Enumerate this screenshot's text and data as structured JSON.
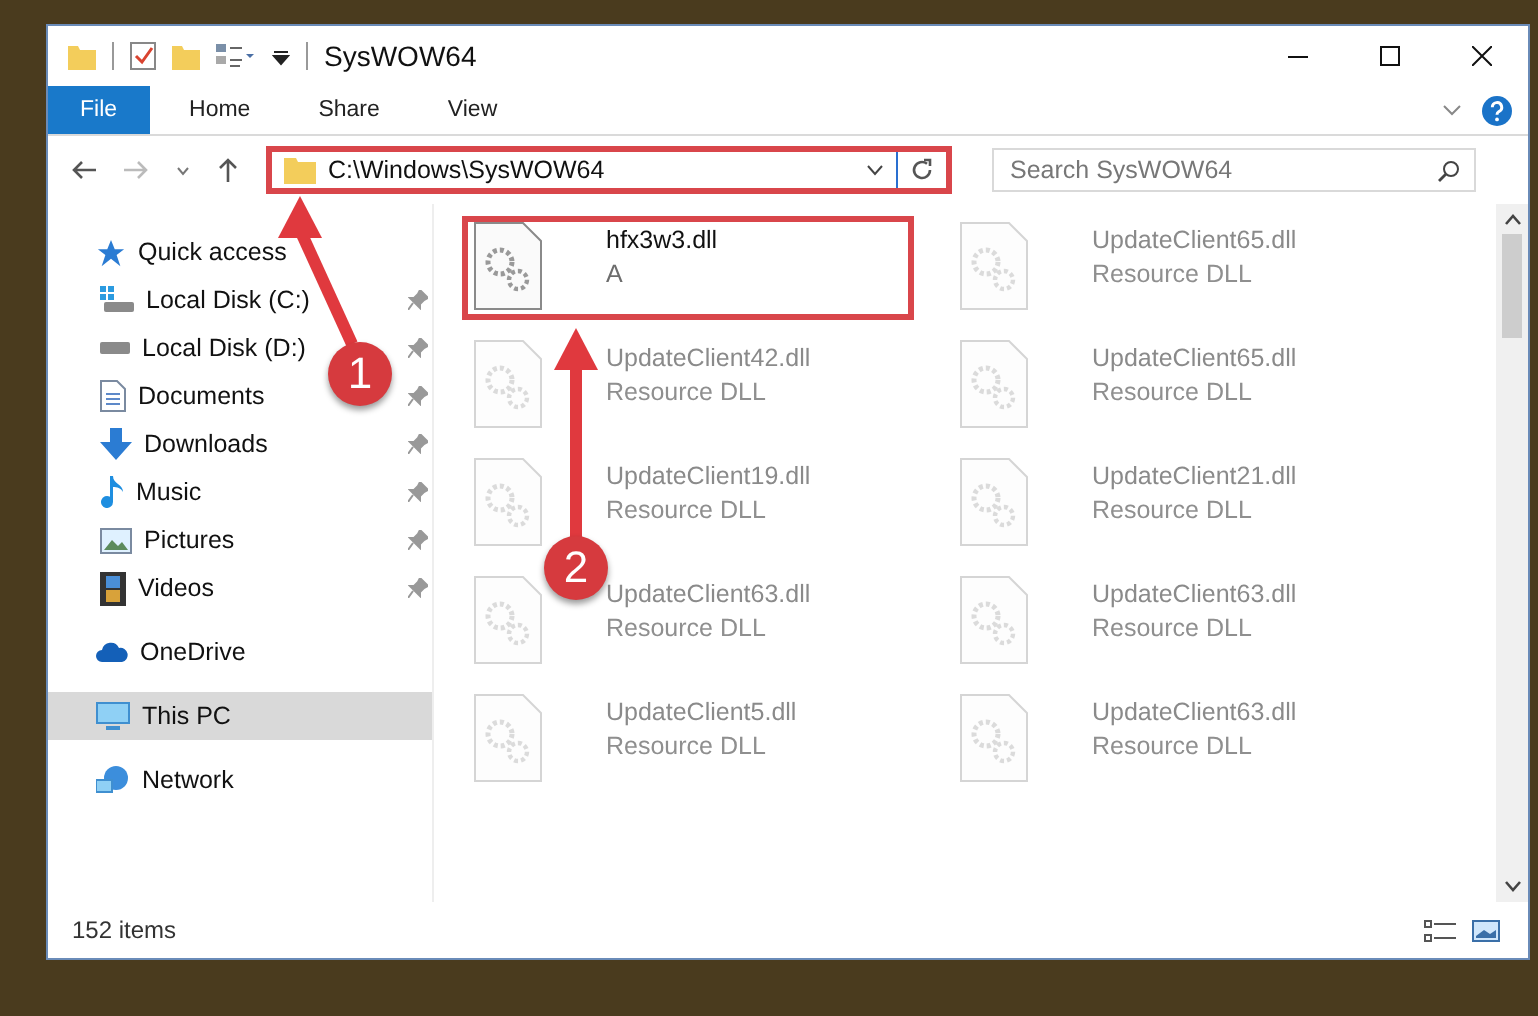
{
  "window": {
    "title": "SysWOW64"
  },
  "ribbon_tabs": [
    {
      "label": "File",
      "selected": true
    },
    {
      "label": "Home",
      "selected": false
    },
    {
      "label": "Share",
      "selected": false
    },
    {
      "label": "View",
      "selected": false
    }
  ],
  "address": {
    "path": "C:\\Windows\\SysWOW64",
    "highlighted": true
  },
  "search": {
    "placeholder": "Search SysWOW64"
  },
  "sidebar": {
    "items": [
      {
        "label": "Quick access",
        "kind": "star",
        "selected": false,
        "children": [
          {
            "label": "Local Disk (C:)",
            "kind": "drive-windows",
            "pinned": true,
            "selected": false
          },
          {
            "label": "Local Disk (D:)",
            "kind": "drive",
            "pinned": true,
            "selected": false
          },
          {
            "label": "Documents",
            "kind": "documents",
            "pinned": true,
            "selected": false
          },
          {
            "label": "Downloads",
            "kind": "downloads",
            "pinned": true,
            "selected": false
          },
          {
            "label": "Music",
            "kind": "music",
            "pinned": true,
            "selected": false
          },
          {
            "label": "Pictures",
            "kind": "pictures",
            "pinned": true,
            "selected": false
          },
          {
            "label": "Videos",
            "kind": "videos",
            "pinned": true,
            "selected": false
          }
        ]
      },
      {
        "label": "OneDrive",
        "kind": "cloud",
        "selected": false
      },
      {
        "label": "This PC",
        "kind": "pc",
        "selected": true
      },
      {
        "label": "Network",
        "kind": "network",
        "selected": false
      }
    ]
  },
  "files": [
    {
      "name": "hfx3w3.dll",
      "type": "A",
      "faded": false,
      "highlighted": true
    },
    {
      "name": "UpdateClient65.dll",
      "type": "Resource DLL",
      "faded": true,
      "highlighted": false
    },
    {
      "name": "UpdateClient42.dll",
      "type": "Resource DLL",
      "faded": true,
      "highlighted": false
    },
    {
      "name": "UpdateClient65.dll",
      "type": "Resource DLL",
      "faded": true,
      "highlighted": false
    },
    {
      "name": "UpdateClient19.dll",
      "type": "Resource DLL",
      "faded": true,
      "highlighted": false
    },
    {
      "name": "UpdateClient21.dll",
      "type": "Resource DLL",
      "faded": true,
      "highlighted": false
    },
    {
      "name": "UpdateClient63.dll",
      "type": "Resource DLL",
      "faded": true,
      "highlighted": false
    },
    {
      "name": "UpdateClient63.dll",
      "type": "Resource DLL",
      "faded": true,
      "highlighted": false
    },
    {
      "name": "UpdateClient5.dll",
      "type": "Resource DLL",
      "faded": true,
      "highlighted": false
    },
    {
      "name": "UpdateClient63.dll",
      "type": "Resource DLL",
      "faded": true,
      "highlighted": false
    }
  ],
  "status_bar": {
    "count": "152 items"
  },
  "callouts": [
    {
      "number": "1"
    },
    {
      "number": "2"
    }
  ]
}
